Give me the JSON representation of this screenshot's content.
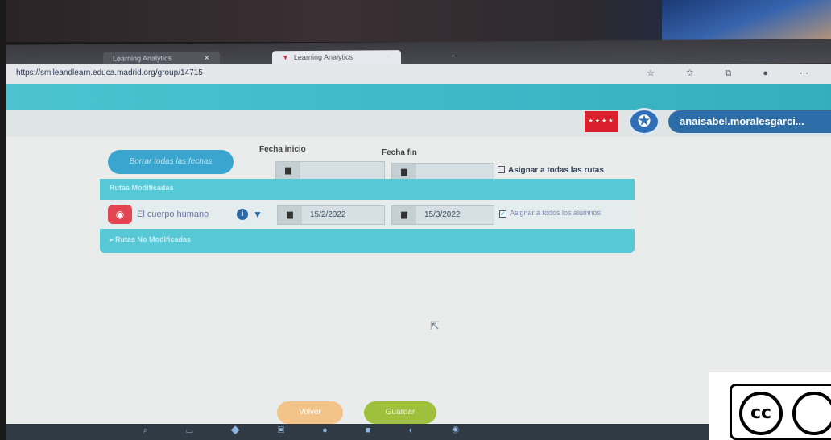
{
  "browser": {
    "tabs": [
      {
        "label": "Learning Analytics",
        "active": false
      },
      {
        "label": "Learning Analytics",
        "active": true
      }
    ],
    "new_tab_label": "+",
    "url": "https://smileandlearn.educa.madrid.org/group/14715",
    "toolbar_icons": "☆ ✩ ⧉ ● ⋯"
  },
  "header": {
    "user_name": "anaisabel.moralesgarci...",
    "flag_stars": "★★★★"
  },
  "controls": {
    "clear_dates_label": "Borrar todas las fechas",
    "start_date_label": "Fecha inicio",
    "end_date_label": "Fecha fin",
    "start_date_value": "",
    "end_date_value": "",
    "assign_all_routes_label": "Asignar a todas las rutas"
  },
  "modified_routes": {
    "section_label": "Rutas Modificadas",
    "items": [
      {
        "name": "El cuerpo humano",
        "start_date": "15/2/2022",
        "end_date": "15/3/2022",
        "assign_all_students_label": "Asignar a todos los alumnos",
        "assign_all_students_checked": true
      }
    ]
  },
  "unmodified_routes": {
    "section_label": "Rutas No Modificadas"
  },
  "footer": {
    "back_label": "Volver",
    "save_label": "Guardar"
  },
  "license_badge": {
    "cc_text": "cc"
  },
  "colors": {
    "teal": "#4cc3cf",
    "blue_button": "#3aa6cf",
    "save_green": "#9ec03c",
    "back_orange": "#f3c48a",
    "user_blue": "#2c6da7"
  }
}
